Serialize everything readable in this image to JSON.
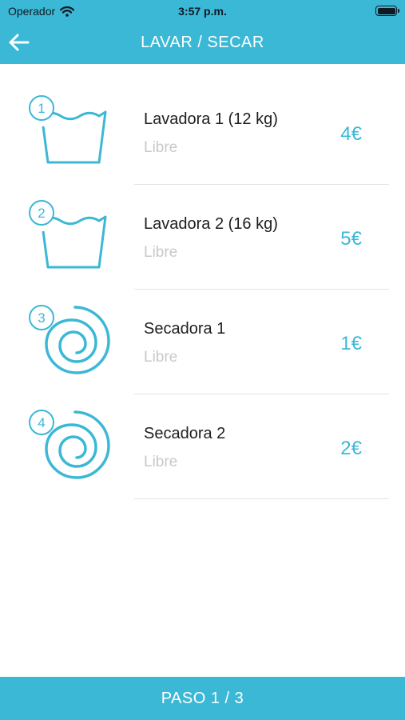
{
  "status_bar": {
    "carrier": "Operador",
    "time": "3:57 p.m."
  },
  "header": {
    "title": "LAVAR / SECAR",
    "back_icon": "arrow-left-icon"
  },
  "machines": [
    {
      "number": "1",
      "name": "Lavadora 1 (12 kg)",
      "status": "Libre",
      "price": "4€",
      "icon": "washer-tub-icon"
    },
    {
      "number": "2",
      "name": "Lavadora 2 (16 kg)",
      "status": "Libre",
      "price": "5€",
      "icon": "washer-tub-icon"
    },
    {
      "number": "3",
      "name": "Secadora 1",
      "status": "Libre",
      "price": "1€",
      "icon": "dryer-spiral-icon"
    },
    {
      "number": "4",
      "name": "Secadora 2",
      "status": "Libre",
      "price": "2€",
      "icon": "dryer-spiral-icon"
    }
  ],
  "footer": {
    "step_label": "PASO 1 / 3"
  },
  "colors": {
    "accent": "#3bb8d6",
    "status_text": "#c9c9c9",
    "divider": "#e3e3e3"
  }
}
